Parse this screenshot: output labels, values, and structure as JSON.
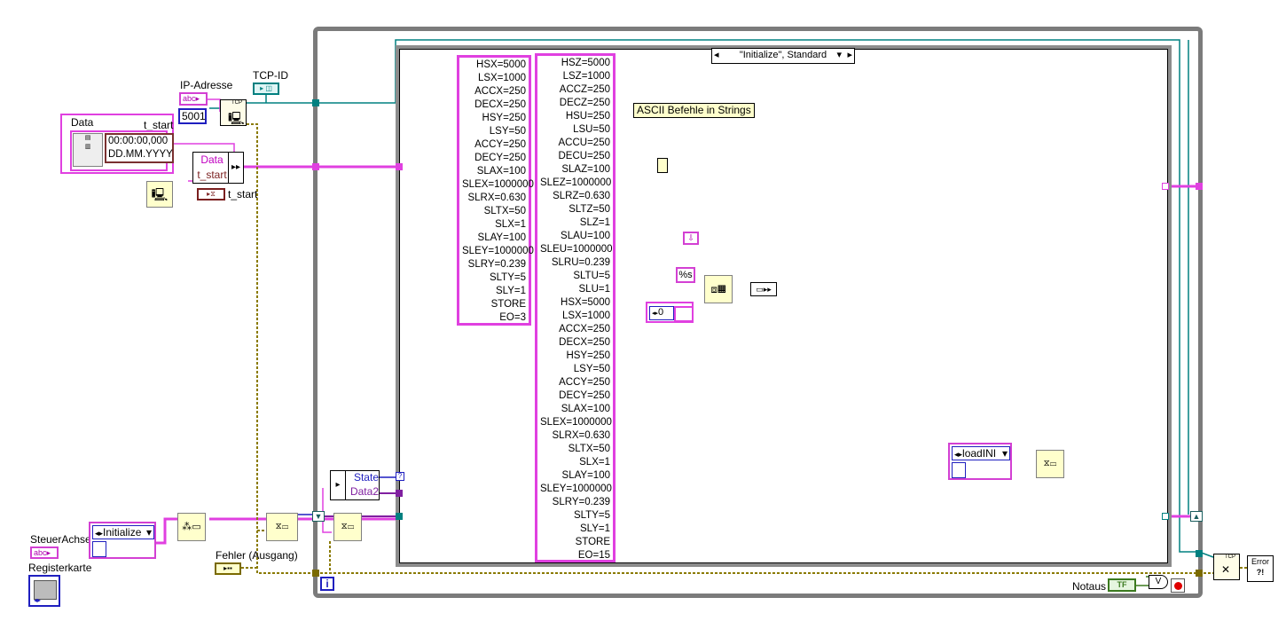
{
  "labels": {
    "ip_address": "IP-Adresse",
    "tcp_id": "TCP-ID",
    "data": "Data",
    "t_start": "t_start",
    "t_start_ref": "t_start",
    "steuer_achse": "SteuerAchse",
    "registerkarte": "Registerkarte",
    "fehler": "Fehler (Ausgang)",
    "notaus": "Notaus"
  },
  "constants": {
    "ip_const": "abc",
    "port": "5001",
    "steuer_const": "abc",
    "time": "00:00:00,000",
    "date": "DD.MM.YYYY",
    "format": "%s",
    "zero": "0",
    "tf": "TF",
    "tcp_vi": "TCP",
    "tcp_close_vi": "TCP",
    "error_vi": "Error",
    "error_q": "?!",
    "or_sym": "V"
  },
  "bundle": {
    "data": "Data",
    "t_start": "t_start"
  },
  "unbundle": {
    "state": "State",
    "data2": "Data2"
  },
  "enums": {
    "state_init": "Initialize",
    "load_ini": "loadINI"
  },
  "case_selector": "\"Initialize\", Standard",
  "comment": "ASCII Befehle in Strings",
  "loop_iteration": "i",
  "string_small": [
    "HSX=5000",
    "LSX=1000",
    "ACCX=250",
    "DECX=250",
    "HSY=250",
    "LSY=50",
    "ACCY=250",
    "DECY=250",
    "SLAX=100",
    "SLEX=1000000",
    "SLRX=0.630",
    "SLTX=50",
    "SLX=1",
    "SLAY=100",
    "SLEY=1000000",
    "SLRY=0.239",
    "SLTY=5",
    "SLY=1",
    "STORE",
    "EO=3"
  ],
  "string_large": [
    "HSZ=5000",
    "LSZ=1000",
    "ACCZ=250",
    "DECZ=250",
    "HSU=250",
    "LSU=50",
    "ACCU=250",
    "DECU=250",
    "SLAZ=100",
    "SLEZ=1000000",
    "SLRZ=0.630",
    "SLTZ=50",
    "SLZ=1",
    "SLAU=100",
    "SLEU=1000000",
    "SLRU=0.239",
    "SLTU=5",
    "SLU=1",
    "HSX=5000",
    "LSX=1000",
    "ACCX=250",
    "DECX=250",
    "HSY=250",
    "LSY=50",
    "ACCY=250",
    "DECY=250",
    "SLAX=100",
    "SLEX=1000000",
    "SLRX=0.630",
    "SLTX=50",
    "SLX=1",
    "SLAY=100",
    "SLEY=1000000",
    "SLRY=0.239",
    "SLTY=5",
    "SLY=1",
    "STORE",
    "EO=15"
  ],
  "colors": {
    "string_wire": "#e040e0",
    "cluster_wire": "#cc00cc",
    "error_wire": "#7a6a00",
    "refnum_wire": "#008080",
    "enum_wire": "#1f1fbf",
    "loop_border": "#7b7b7b",
    "case_border": "#8c8c8c"
  }
}
